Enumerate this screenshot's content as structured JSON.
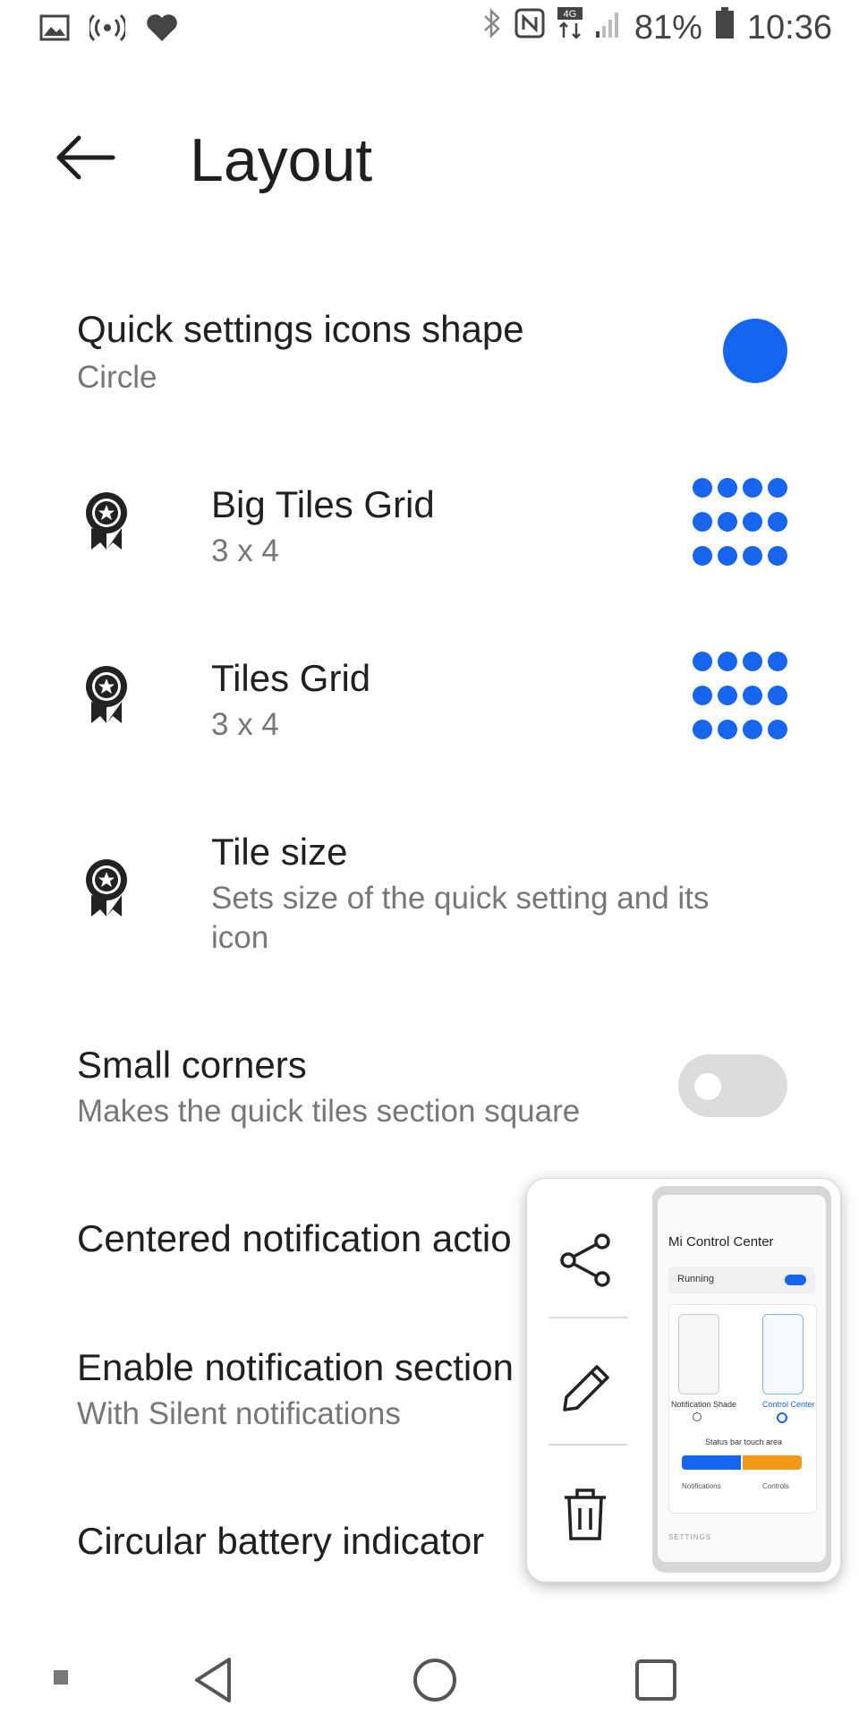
{
  "status_bar": {
    "battery": "81%",
    "time": "10:36",
    "network": "4G"
  },
  "app_bar": {
    "title": "Layout"
  },
  "settings": [
    {
      "title": "Quick settings icons shape",
      "subtitle": "Circle"
    },
    {
      "title": "Big Tiles Grid",
      "subtitle": "3 x 4"
    },
    {
      "title": "Tiles Grid",
      "subtitle": "3 x 4"
    },
    {
      "title": "Tile size",
      "subtitle": "Sets size of the quick setting and its",
      "subtitle2": "icon"
    },
    {
      "title": "Small corners",
      "subtitle": "Makes the quick tiles section square",
      "toggle": "off"
    },
    {
      "title": "Centered notification actio"
    },
    {
      "title": "Enable notification section",
      "subtitle": "With Silent notifications"
    },
    {
      "title": "Circular battery indicator"
    }
  ],
  "popup": {
    "actions": [
      "share-icon",
      "edit-icon",
      "delete-icon"
    ],
    "thumbnail": {
      "title": "Mi Control Center",
      "running": "Running",
      "option1": "Notification Shade",
      "option2": "Control Center",
      "area_label": "Status bar touch area",
      "notifications": "Notifications",
      "controls": "Controls",
      "settings": "SETTINGS"
    }
  },
  "colors": {
    "accent": "#1565f0",
    "orange": "#f09a1a"
  }
}
